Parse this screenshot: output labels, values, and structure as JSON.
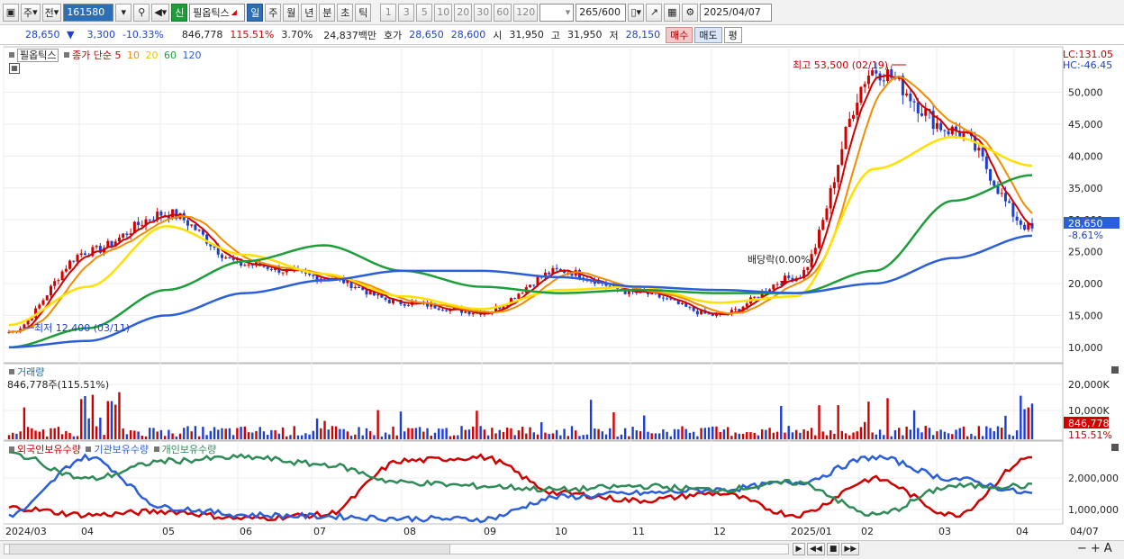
{
  "toolbar": {
    "period_label": "주",
    "prev_label": "전",
    "code": "161580",
    "badge": "신",
    "name": "필옵틱스",
    "period_tabs": [
      "일",
      "주",
      "월",
      "년",
      "분",
      "초",
      "틱"
    ],
    "selected_tab": "일",
    "intervals": [
      "1",
      "3",
      "5",
      "10",
      "20",
      "30",
      "60",
      "120"
    ],
    "count": "265",
    "count_max": "/600",
    "date": "2025/04/07"
  },
  "quote": {
    "price": "28,650",
    "change": "3,300",
    "change_pct": "-10.33%",
    "volume": "846,778",
    "vol_ratio": "115.51%",
    "turnover_pct": "3.70%",
    "amount": "24,837백만",
    "hoga_label": "호가",
    "ask": "28,650",
    "bid": "28,600",
    "open_label": "시",
    "open": "31,950",
    "high_label": "고",
    "high": "31,950",
    "low_label": "저",
    "low": "28,150",
    "buy_label": "매수",
    "sell_label": "매도",
    "avg_label": "평"
  },
  "price_panel": {
    "name": "필옵틱스",
    "legend_prefix": "종가 단순",
    "ma_labels": [
      "5",
      "10",
      "20",
      "60",
      "120"
    ],
    "lc": "LC:131.05",
    "hc": "HC:-46.45",
    "max_label": "최고 53,500 (02/19)",
    "min_label": "최저 12,400 (03/11)",
    "dividend_label": "배당락(0.00%)",
    "price_tag": "28,650",
    "pct_tag": "-8.61%",
    "y_ticks": [
      "50,000",
      "45,000",
      "40,000",
      "35,000",
      "30,000",
      "25,000",
      "20,000",
      "15,000",
      "10,000"
    ]
  },
  "volume_panel": {
    "title": "거래량",
    "info": "846,778주(115.51%)",
    "y_ticks": [
      "20,000K",
      "10,000K"
    ],
    "vol_tag": "846,778",
    "vol_pct_tag": "115.51%"
  },
  "holder_panel": {
    "foreign": "외국인보유수량",
    "inst": "기관보유수량",
    "indiv": "개인보유수량",
    "y_ticks": [
      "2,000,000",
      "1,000,000"
    ]
  },
  "x_axis": [
    "2024/03",
    "04",
    "05",
    "06",
    "07",
    "08",
    "09",
    "10",
    "11",
    "12",
    "2025/01",
    "02",
    "03",
    "04",
    "04/07"
  ],
  "colors": {
    "up": "#d00000",
    "down": "#1c3fd1",
    "ma5": "#d00000",
    "ma10": "#f28c00",
    "ma20": "#ffe000",
    "ma60": "#1e9e3a",
    "ma120": "#2b5fd9",
    "foreign": "#d00000",
    "inst": "#2b5fd9",
    "indiv": "#2e8b57"
  },
  "chart_data": {
    "type": "line",
    "title": "필옵틱스",
    "x": [
      "2024/03/11",
      "2024/04",
      "2024/05",
      "2024/06",
      "2024/07",
      "2024/08",
      "2024/09",
      "2024/10",
      "2024/11",
      "2024/12",
      "2025/01",
      "2025/02/19",
      "2025/03",
      "2025/04/07"
    ],
    "series": [
      {
        "name": "종가",
        "values": [
          12400,
          25000,
          31000,
          23000,
          21000,
          17000,
          15500,
          22000,
          18500,
          15000,
          21000,
          53500,
          44000,
          28650
        ]
      },
      {
        "name": "20",
        "values": [
          13500,
          19500,
          29000,
          24500,
          21500,
          18000,
          16000,
          19000,
          19500,
          17000,
          18000,
          38000,
          43000,
          38500
        ]
      },
      {
        "name": "60",
        "values": [
          10000,
          13000,
          19000,
          23500,
          26000,
          22000,
          19500,
          18500,
          19000,
          18500,
          18500,
          22000,
          33000,
          37000
        ]
      },
      {
        "name": "120",
        "values": [
          10000,
          11000,
          15000,
          18500,
          20500,
          22000,
          22000,
          21000,
          19500,
          19000,
          18500,
          20000,
          24000,
          27500
        ]
      }
    ],
    "ylim": [
      8000,
      56000
    ]
  }
}
